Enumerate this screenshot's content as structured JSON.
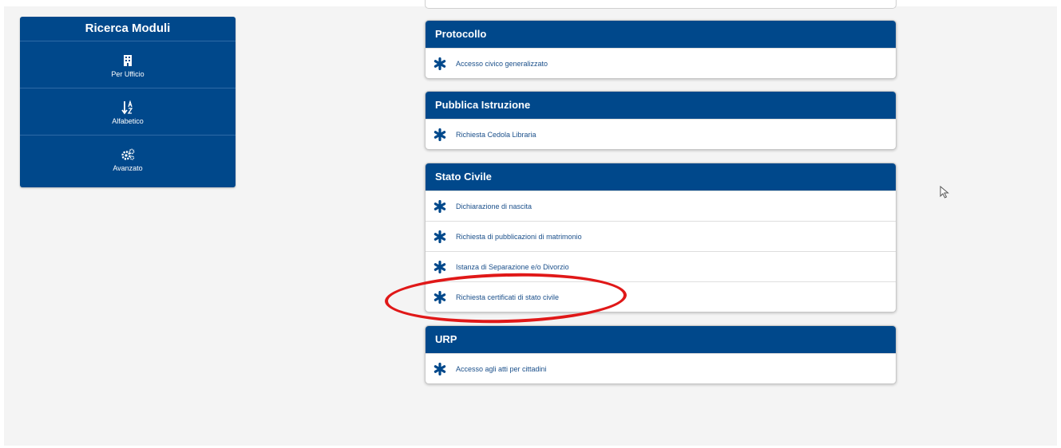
{
  "sidebar": {
    "title": "Ricerca Moduli",
    "items": [
      {
        "label": "Per Ufficio",
        "icon": "building-icon"
      },
      {
        "label": "Alfabetico",
        "icon": "sort-alpha-icon"
      },
      {
        "label": "Avanzato",
        "icon": "gears-icon"
      }
    ]
  },
  "panels": [
    {
      "title": "Protocollo",
      "items": [
        "Accesso civico generalizzato"
      ]
    },
    {
      "title": "Pubblica Istruzione",
      "items": [
        "Richiesta Cedola Libraria"
      ]
    },
    {
      "title": "Stato Civile",
      "items": [
        "Dichiarazione di nascita",
        "Richiesta di pubblicazioni di matrimonio",
        "Istanza di Separazione e/o Divorzio",
        "Richiesta certificati di stato civile"
      ]
    },
    {
      "title": "URP",
      "items": [
        "Accesso agli atti per cittadini"
      ]
    }
  ],
  "colors": {
    "brand": "#00488b",
    "link": "#1a4f8a",
    "highlight": "#e01818"
  }
}
